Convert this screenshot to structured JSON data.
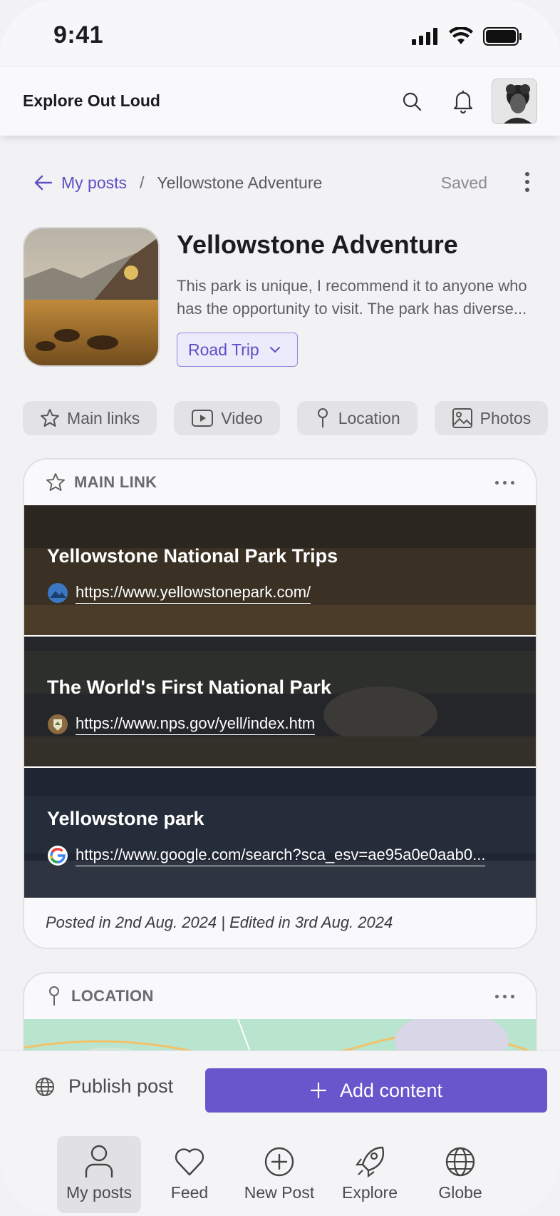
{
  "status_bar": {
    "time": "9:41"
  },
  "header": {
    "brand": "Explore Out Loud"
  },
  "breadcrumb": {
    "back_label": "My posts",
    "separator": "/",
    "current": "Yellowstone Adventure",
    "saved": "Saved"
  },
  "post": {
    "title": "Yellowstone Adventure",
    "description": "This park is unique, I recommend it to anyone who has the opportunity to visit. The park has diverse...",
    "category": "Road Trip"
  },
  "tabs": [
    {
      "label": "Main links",
      "icon": "star-icon"
    },
    {
      "label": "Video",
      "icon": "video-icon"
    },
    {
      "label": "Location",
      "icon": "pin-icon"
    },
    {
      "label": "Photos",
      "icon": "image-icon"
    }
  ],
  "main_link_card": {
    "heading": "MAIN LINK",
    "links": [
      {
        "title": "Yellowstone National Park Trips",
        "url": "https://www.yellowstonepark.com/"
      },
      {
        "title": "The World's First National Park",
        "url": "https://www.nps.gov/yell/index.htm"
      },
      {
        "title": "Yellowstone park",
        "url": "https://www.google.com/search?sca_esv=ae95a0e0aab0..."
      }
    ],
    "footnote": "Posted in 2nd Aug. 2024  |  Edited in 3rd Aug. 2024"
  },
  "location_card": {
    "heading": "LOCATION"
  },
  "actions": {
    "publish_label": "Publish post",
    "add_label": "Add content"
  },
  "tabbar": [
    {
      "label": "My posts",
      "icon": "person-icon",
      "active": true
    },
    {
      "label": "Feed",
      "icon": "heart-icon"
    },
    {
      "label": "New Post",
      "icon": "plus-circle-icon"
    },
    {
      "label": "Explore",
      "icon": "rocket-icon"
    },
    {
      "label": "Globe",
      "icon": "globe-icon"
    }
  ],
  "colors": {
    "accent": "#6a56cc",
    "accent_text": "#5b4fc6",
    "background": "#f2f2f4"
  }
}
